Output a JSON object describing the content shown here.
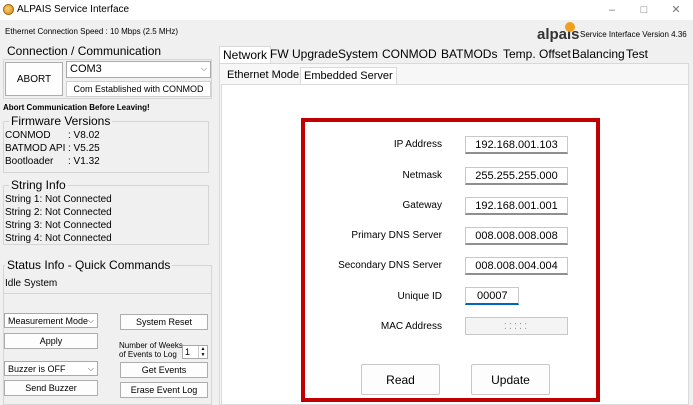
{
  "app": {
    "title": "ALPAIS Service Interface",
    "version_text": "Service Interface Version 4.36",
    "logo_text": "alpais"
  },
  "window": {
    "minimize": "–",
    "maximize": "□",
    "close": "✕"
  },
  "speed_label": "Ethernet Connection Speed : 10 Mbps (2.5 MHz)",
  "connection": {
    "title": "Connection / Communication",
    "abort_label": "ABORT",
    "port_value": "COM3",
    "status": "Com Established with CONMOD",
    "warning": "Abort Communication Before Leaving!"
  },
  "firmware": {
    "title": "Firmware Versions",
    "rows": [
      {
        "name": "CONMOD",
        "value": ": V8.02"
      },
      {
        "name": "BATMOD API",
        "value": ": V5.25"
      },
      {
        "name": "Bootloader",
        "value": ": V1.32"
      }
    ]
  },
  "strings": {
    "title": "String Info",
    "rows": [
      "String 1: Not Connected",
      "String 2: Not Connected",
      "String 3: Not Connected",
      "String 4: Not Connected"
    ]
  },
  "status": {
    "title": "Status Info - Quick Commands",
    "state": "Idle System",
    "mode_value": "Measurement Mode",
    "apply_label": "Apply",
    "system_reset_label": "System Reset",
    "weeks_label_1": "Number of Weeks",
    "weeks_label_2": "of Events to Log",
    "weeks_value": "1",
    "buzzer_value": "Buzzer is OFF",
    "get_events_label": "Get Events",
    "send_buzzer_label": "Send Buzzer",
    "erase_log_label": "Erase Event Log"
  },
  "tabs": [
    "Network",
    "FW Upgrade",
    "System",
    "CONMOD",
    "BATMODs",
    "Temp. Offset",
    "Balancing",
    "Test"
  ],
  "subtabs": [
    "Ethernet Mode",
    "Embedded Server"
  ],
  "form": {
    "ip_label": "IP Address",
    "ip_value": "192.168.001.103",
    "netmask_label": "Netmask",
    "netmask_value": "255.255.255.000",
    "gateway_label": "Gateway",
    "gateway_value": "192.168.001.001",
    "pdns_label": "Primary DNS Server",
    "pdns_value": "008.008.008.008",
    "sdns_label": "Secondary DNS Server",
    "sdns_value": "008.008.004.004",
    "uid_label": "Unique ID",
    "uid_value": "00007",
    "mac_label": "MAC Address",
    "mac_value": ":::::",
    "read_label": "Read",
    "update_label": "Update"
  },
  "colors": {
    "highlight_border": "#c00000",
    "logo_orange": "#f0a020",
    "logo_text": "#333333"
  }
}
